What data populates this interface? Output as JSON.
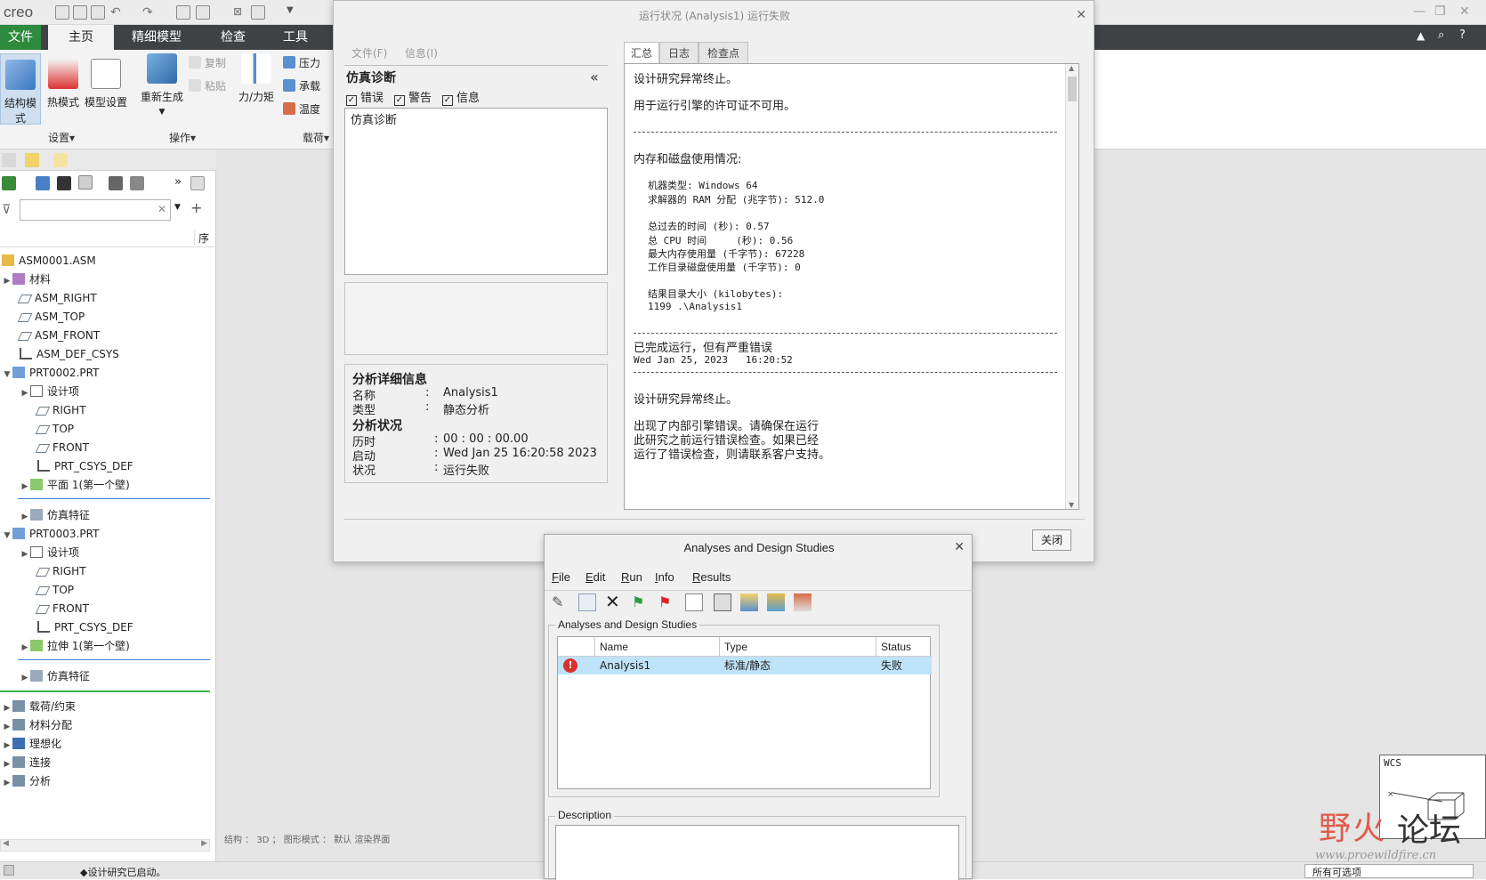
{
  "app": {
    "logo": "creo"
  },
  "menubar": {
    "tabs": [
      "文件",
      "主页",
      "精细模型",
      "检查",
      "工具"
    ]
  },
  "ribbon": {
    "buttons": [
      "结构模式",
      "热模式",
      "模型设置",
      "重新生成",
      "力/力矩"
    ],
    "small": [
      "复制",
      "粘贴",
      "压力",
      "承载",
      "温度"
    ],
    "groups": [
      "设置",
      "操作",
      "载荷"
    ]
  },
  "tree": {
    "column_label": "序",
    "filter_placeholder": "",
    "items": [
      {
        "label": "ASM0001.ASM"
      },
      {
        "label": "材料"
      },
      {
        "label": "ASM_RIGHT"
      },
      {
        "label": "ASM_TOP"
      },
      {
        "label": "ASM_FRONT"
      },
      {
        "label": "ASM_DEF_CSYS"
      },
      {
        "label": "PRT0002.PRT"
      },
      {
        "label": "设计项"
      },
      {
        "label": "RIGHT"
      },
      {
        "label": "TOP"
      },
      {
        "label": "FRONT"
      },
      {
        "label": "PRT_CSYS_DEF"
      },
      {
        "label": "平面 1(第一个壁)"
      },
      {
        "label": "仿真特征"
      },
      {
        "label": "PRT0003.PRT"
      },
      {
        "label": "设计项"
      },
      {
        "label": "RIGHT"
      },
      {
        "label": "TOP"
      },
      {
        "label": "FRONT"
      },
      {
        "label": "PRT_CSYS_DEF"
      },
      {
        "label": "拉伸 1(第一个壁)"
      },
      {
        "label": "仿真特征"
      },
      {
        "label": "载荷/约束"
      },
      {
        "label": "材料分配"
      },
      {
        "label": "理想化"
      },
      {
        "label": "连接"
      },
      {
        "label": "分析"
      }
    ]
  },
  "graphics": {
    "status": "结构 ： 3D ； 图形模式 ： 默认 渲染界面",
    "wcs": "WCS"
  },
  "watermark": {
    "text1": "野火",
    "text2": "论坛",
    "url": "www.proewildfire.cn"
  },
  "run_dialog": {
    "title": "运行状况 (Analysis1) 运行失败",
    "menu": [
      "文件(F)",
      "信息(I)"
    ],
    "diag_title": "仿真诊断",
    "checks": [
      "错误",
      "警告",
      "信息"
    ],
    "diag_list": [
      "仿真诊断"
    ],
    "detail_title": "分析详细信息",
    "name_label": "名称",
    "name_value": "Analysis1",
    "type_label": "类型",
    "type_value": "静态分析",
    "status_title": "分析状况",
    "elapsed_label": "历时",
    "elapsed_value": "00 : 00 : 00.00",
    "start_label": "启动",
    "start_value": "Wed Jan 25 16:20:58 2023",
    "state_label": "状况",
    "state_value": "运行失败",
    "tabs": [
      "汇总",
      "日志",
      "检查点"
    ],
    "summary": {
      "l1": "设计研究异常终止。",
      "l2": "用于运行引擎的许可证不可用。",
      "l3": "内存和磁盘使用情况:",
      "l4": "机器类型: Windows 64",
      "l5": "求解器的 RAM 分配 (兆字节): 512.0",
      "l6": "总过去的时间 (秒): 0.57",
      "l7": "总 CPU 时间     (秒): 0.56",
      "l8": "最大内存使用量 (千字节): 67228",
      "l9": "工作目录磁盘使用量 (千字节): 0",
      "l10": "结果目录大小 (kilobytes):",
      "l11": "1199 .\\Analysis1",
      "l12": "已完成运行，但有严重错误",
      "l13": "Wed Jan 25, 2023   16:20:52",
      "l14": "设计研究异常终止。",
      "l15": "出现了内部引擎错误。请确保在运行",
      "l16": "此研究之前运行错误检查。如果已经",
      "l17": "运行了错误检查，则请联系客户支持。"
    },
    "close_label": "关闭"
  },
  "analyses_dialog": {
    "title": "Analyses and Design Studies",
    "menu": [
      {
        "u": "F",
        "rest": "ile"
      },
      {
        "u": "E",
        "rest": "dit"
      },
      {
        "u": "R",
        "rest": "un"
      },
      {
        "u": "I",
        "rest": "nfo"
      },
      {
        "u": "R",
        "rest": "esults"
      }
    ],
    "group_label": "Analyses and Design Studies",
    "columns": [
      "Name",
      "Type",
      "Status"
    ],
    "rows": [
      {
        "name": "Analysis1",
        "type": "标准/静态",
        "status": "失败"
      }
    ],
    "description_label": "Description"
  },
  "statusbar": {
    "message": "◆设计研究已启动。",
    "right": "所有可选项"
  },
  "colors": {
    "menubar": "#3f4245",
    "file_tab": "#2e8b3e",
    "selected_row": "#bfe3f8",
    "error": "#d9302c"
  }
}
